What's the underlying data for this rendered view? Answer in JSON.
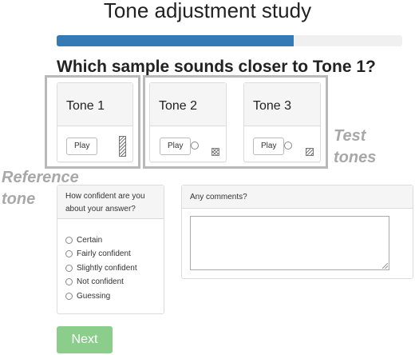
{
  "header": {
    "title": "Tone adjustment study"
  },
  "progress": {
    "fraction": 0.685,
    "color": "#337ab7"
  },
  "question": "Which sample sounds closer to Tone 1?",
  "tones": [
    {
      "title": "Tone 1",
      "play_label": "Play",
      "has_radio": false,
      "pattern": "diagonal-hatch-icon"
    },
    {
      "title": "Tone 2",
      "play_label": "Play",
      "has_radio": true,
      "pattern": "crosshatch-icon"
    },
    {
      "title": "Tone 3",
      "play_label": "Play",
      "has_radio": true,
      "pattern": "diagonal-hatch-icon"
    }
  ],
  "annotations": {
    "reference": "Reference tone",
    "test": "Test tones"
  },
  "confidence": {
    "prompt": "How confident are you about your answer?",
    "options": [
      "Certain",
      "Fairly confident",
      "Slightly confident",
      "Not confident",
      "Guessing"
    ]
  },
  "comments": {
    "label": "Any comments?",
    "value": ""
  },
  "next_label": "Next",
  "colors": {
    "accent": "#337ab7",
    "next_button": "#8bce8b",
    "annotation": "#a8a8a8"
  }
}
